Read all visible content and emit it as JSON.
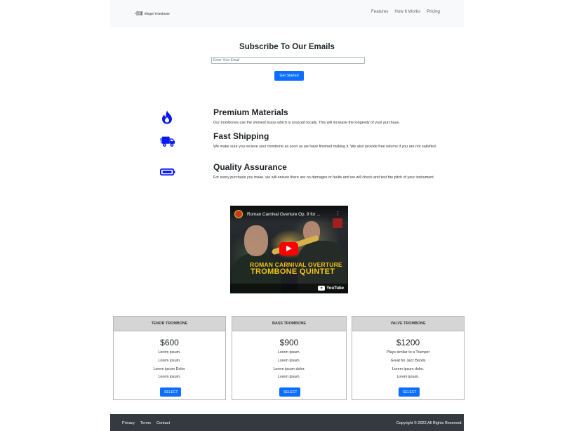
{
  "header": {
    "logo_text": "Illegal Trombone",
    "nav": [
      "Features",
      "How It Works",
      "Pricing"
    ]
  },
  "subscribe": {
    "title": "Subscribe To Our Emails",
    "email_placeholder": "Enter Your Email",
    "button": "Get Started"
  },
  "features": [
    {
      "icon": "fire-icon",
      "title": "Premium Materials",
      "text": "Our trombones use the shiniest brass which is sourced locally. This will increase the longevity of your purchase."
    },
    {
      "icon": "truck-icon",
      "title": "Fast Shipping",
      "text": "We make sure you recieve your trombone as soon as we have finished making it. We also provide free returns if you are not satisfied."
    },
    {
      "icon": "battery-icon",
      "title": "Quality Assurance",
      "text": "For every purchase you make, we will ensure there are no damages or faults and we will check and test the pitch of your instrument."
    }
  ],
  "video": {
    "title": "Roman Carnival Overture Op. 9 for ...",
    "overlay_line1": "ROMAN CARNIVAL OVERTURE",
    "overlay_line2": "TROMBONE QUINTET",
    "brand": "YouTube"
  },
  "pricing": [
    {
      "name": "TENOR TROMBONE",
      "price": "$600",
      "features": [
        "Lorem ipsum.",
        "Lorem ipsum.",
        "Lorem ipsum Dolor.",
        "Lorem ipsum."
      ],
      "button": "SELECT"
    },
    {
      "name": "BASS TROMBONE",
      "price": "$900",
      "features": [
        "Lorem ipsum.",
        "Lorem ipsum.",
        "Lorem ipsum dolor.",
        "Lorem ipsum."
      ],
      "button": "SELECT"
    },
    {
      "name": "VALVE TROMBONE",
      "price": "$1200",
      "features": [
        "Plays similar to a Trumpet",
        "Great for Jazz Bands",
        "Lorem ipsum dolor.",
        "Lorem ipsum."
      ],
      "button": "SELECT"
    }
  ],
  "footer": {
    "links": [
      "Privacy",
      "Terms",
      "Contact"
    ],
    "copyright": "Copyright © 2022,All Rights Reserved."
  },
  "colors": {
    "primary": "#0d6efd",
    "icon_blue": "#0a18f0",
    "footer_bg": "#343a40",
    "header_bg": "#f8f9fa"
  }
}
